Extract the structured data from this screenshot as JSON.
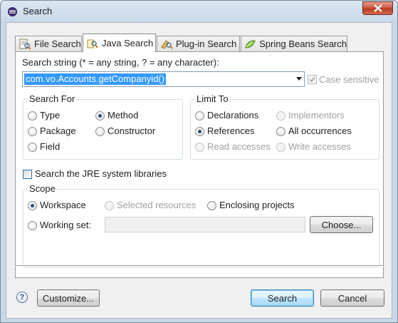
{
  "window": {
    "title": "Search"
  },
  "tabs": [
    {
      "label": "File Search",
      "icon": "file-search-icon"
    },
    {
      "label": "Java Search",
      "icon": "java-search-icon"
    },
    {
      "label": "Plug-in Search",
      "icon": "plugin-search-icon"
    },
    {
      "label": "Spring Beans Search",
      "icon": "spring-beans-icon"
    }
  ],
  "search_string": {
    "label": "Search string (* = any string, ? = any character):",
    "value": "com.vo.Accounts.getCompanyid()",
    "case_sensitive_label": "Case sensitive",
    "case_sensitive_checked": true,
    "case_sensitive_enabled": false
  },
  "search_for": {
    "title": "Search For",
    "options": [
      {
        "label": "Type",
        "checked": false
      },
      {
        "label": "Method",
        "checked": true
      },
      {
        "label": "Package",
        "checked": false
      },
      {
        "label": "Constructor",
        "checked": false
      },
      {
        "label": "Field",
        "checked": false
      }
    ]
  },
  "limit_to": {
    "title": "Limit To",
    "options": [
      {
        "label": "Declarations",
        "checked": false,
        "enabled": true
      },
      {
        "label": "Implementors",
        "checked": false,
        "enabled": false
      },
      {
        "label": "References",
        "checked": true,
        "enabled": true
      },
      {
        "label": "All occurrences",
        "checked": false,
        "enabled": true
      },
      {
        "label": "Read accesses",
        "checked": false,
        "enabled": false
      },
      {
        "label": "Write accesses",
        "checked": false,
        "enabled": false
      }
    ]
  },
  "jre": {
    "label": "Search the JRE system libraries",
    "checked": false
  },
  "scope": {
    "title": "Scope",
    "workspace": "Workspace",
    "selected_resources": "Selected resources",
    "enclosing_projects": "Enclosing projects",
    "working_set": "Working set:",
    "working_set_value": "",
    "choose_button": "Choose...",
    "selected": "Workspace"
  },
  "footer": {
    "customize_button": "Customize...",
    "search_button": "Search",
    "cancel_button": "Cancel"
  },
  "colors": {
    "selection": "#3399ff",
    "panel": "#ffffff",
    "dialog": "#f0f0f0",
    "close": "#c7533c"
  }
}
